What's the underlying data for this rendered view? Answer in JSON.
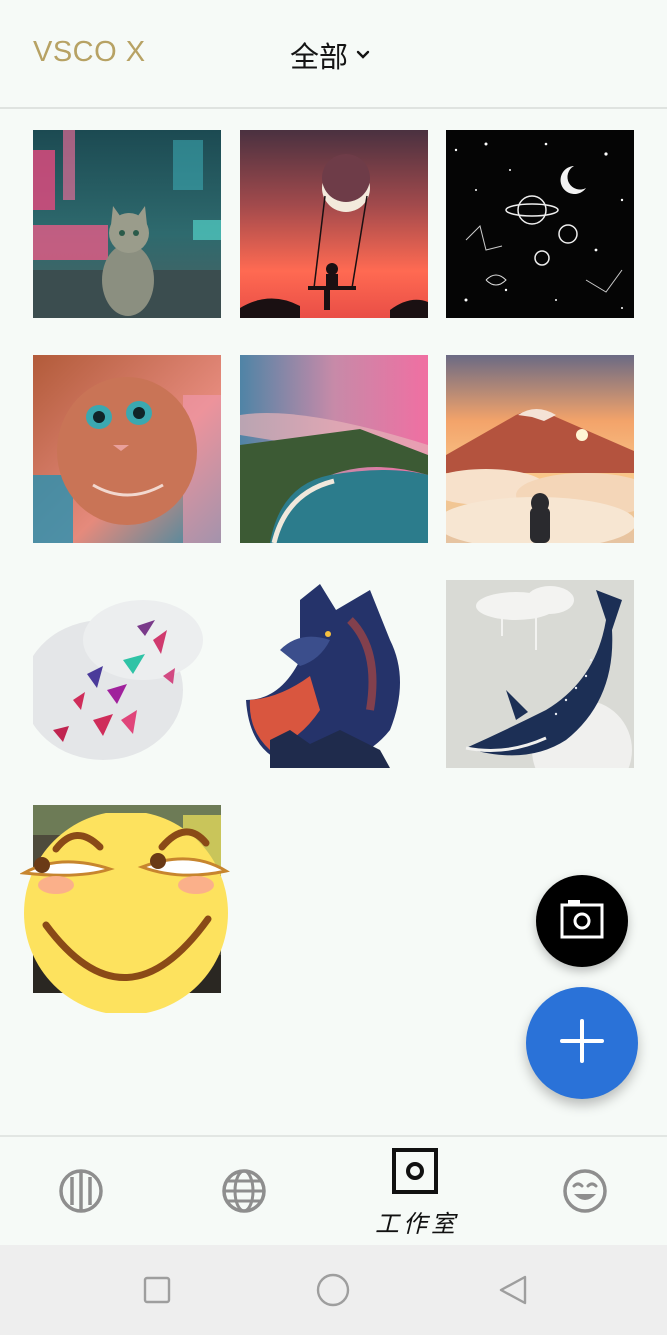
{
  "header": {
    "brand": "VSCO X",
    "filter_label": "全部"
  },
  "icons": {
    "filter_dropdown": "chevron-down-icon",
    "camera": "camera-icon",
    "add": "plus-icon",
    "nav_feed": "feed-circle-icon",
    "nav_discover": "globe-icon",
    "nav_studio": "studio-square-icon",
    "nav_profile": "smiley-face-icon"
  },
  "gallery": {
    "tiles": [
      {
        "subject": "cat-neon-street"
      },
      {
        "subject": "moon-swing-silhouette"
      },
      {
        "subject": "space-doodles"
      },
      {
        "subject": "cat-closeup-pink"
      },
      {
        "subject": "coastal-cliffs-sunset"
      },
      {
        "subject": "mountain-above-clouds"
      },
      {
        "subject": "origami-birds-watercolor"
      },
      {
        "subject": "fox-double-exposure"
      },
      {
        "subject": "whale-paint-drip"
      },
      {
        "subject": "photo-with-emoji-sticker"
      }
    ]
  },
  "bottom_nav": {
    "studio_label": "工作室",
    "active": "studio"
  },
  "colors": {
    "brand": "#b7a264",
    "fab_add": "#2a72d8",
    "fab_camera": "#000000",
    "background": "#f6faf7"
  }
}
